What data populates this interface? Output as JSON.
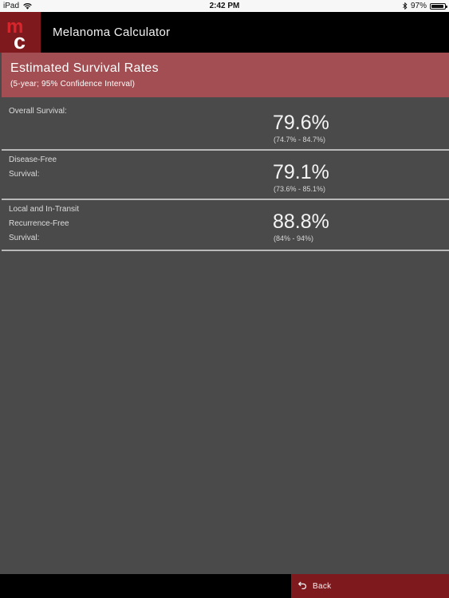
{
  "status_bar": {
    "device": "iPad",
    "time": "2:42 PM",
    "battery": "97%",
    "icons": [
      "wifi-icon",
      "bluetooth-icon",
      "battery-icon"
    ]
  },
  "header": {
    "logo_text": "mc",
    "title": "Melanoma Calculator"
  },
  "banner": {
    "title": "Estimated Survival Rates",
    "subtitle": "(5-year; 95% Confidence Interval)"
  },
  "results": [
    {
      "label_lines": [
        "Overall Survival:"
      ],
      "value": "79.6%",
      "ci": "(74.7% - 84.7%)"
    },
    {
      "label_lines": [
        "Disease-Free",
        "Survival:"
      ],
      "value": "79.1%",
      "ci": "(73.6% - 85.1%)"
    },
    {
      "label_lines": [
        "Local and In-Transit",
        "Recurrence-Free",
        "Survival:"
      ],
      "value": "88.8%",
      "ci": "(84% - 94%)"
    }
  ],
  "footer": {
    "back_label": "Back",
    "back_icon": "undo-arrow-icon"
  },
  "colors": {
    "brand_red": "#7e1a1e",
    "banner_red": "#a24e52",
    "background": "#4a4a4a"
  }
}
